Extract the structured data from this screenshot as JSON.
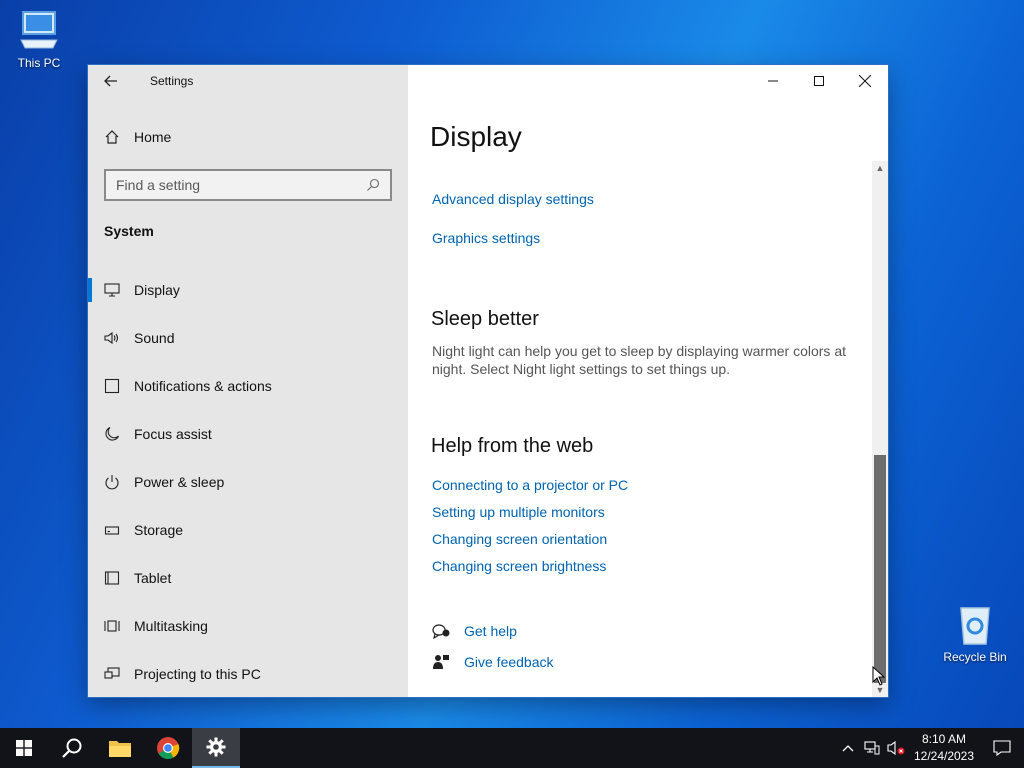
{
  "desktop": {
    "icons": [
      {
        "label": "This PC"
      },
      {
        "label": "Recycle Bin"
      }
    ]
  },
  "window": {
    "app_title": "Settings",
    "sidebar": {
      "home_label": "Home",
      "search_placeholder": "Find a setting",
      "section_label": "System",
      "items": [
        {
          "label": "Display",
          "icon": "monitor-icon",
          "active": true
        },
        {
          "label": "Sound",
          "icon": "speaker-icon"
        },
        {
          "label": "Notifications & actions",
          "icon": "notification-icon"
        },
        {
          "label": "Focus assist",
          "icon": "moon-icon"
        },
        {
          "label": "Power & sleep",
          "icon": "power-icon"
        },
        {
          "label": "Storage",
          "icon": "storage-icon"
        },
        {
          "label": "Tablet",
          "icon": "tablet-icon"
        },
        {
          "label": "Multitasking",
          "icon": "multitasking-icon"
        },
        {
          "label": "Projecting to this PC",
          "icon": "projecting-icon"
        }
      ]
    },
    "content": {
      "title": "Display",
      "links": [
        "Advanced display settings",
        "Graphics settings"
      ],
      "sleep": {
        "heading": "Sleep better",
        "text": "Night light can help you get to sleep by displaying warmer colors at night. Select Night light settings to set things up."
      },
      "help": {
        "heading": "Help from the web",
        "links": [
          "Connecting to a projector or PC",
          "Setting up multiple monitors",
          "Changing screen orientation",
          "Changing screen brightness"
        ]
      },
      "get_help": "Get help",
      "give_feedback": "Give feedback"
    }
  },
  "taskbar": {
    "time": "8:10 AM",
    "date": "12/24/2023"
  },
  "colors": {
    "accent": "#0078d7",
    "link": "#0063b1"
  }
}
